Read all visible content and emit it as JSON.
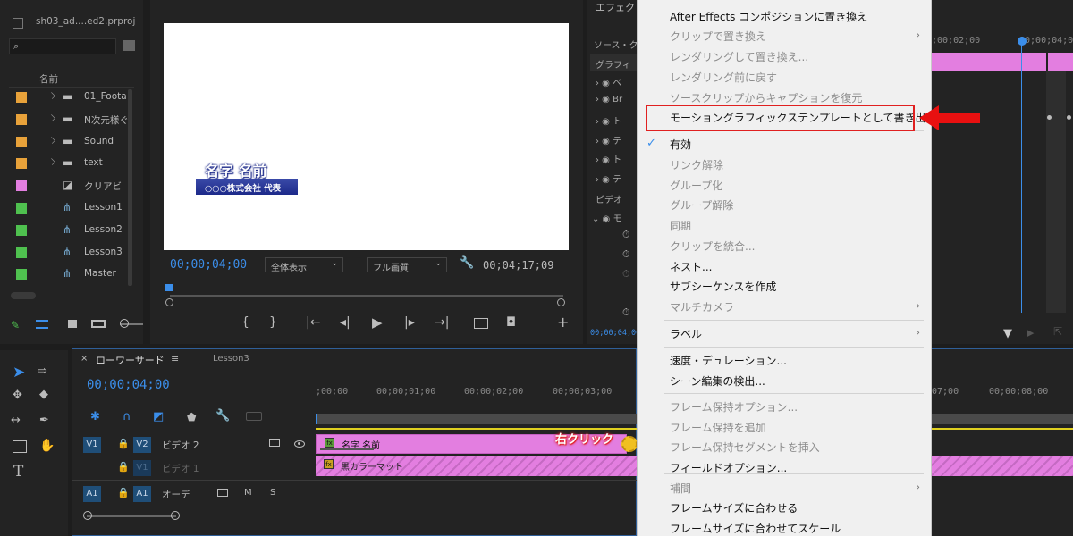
{
  "project": {
    "filename": "sh03_ad....ed2.prproj",
    "col_name": "名前",
    "items": [
      {
        "label": "01_Foota",
        "color": "#e8a23a",
        "kind": "folder"
      },
      {
        "label": "N次元様ぐ",
        "color": "#e8a23a",
        "kind": "folder"
      },
      {
        "label": "Sound",
        "color": "#e8a23a",
        "kind": "folder"
      },
      {
        "label": "text",
        "color": "#e8a23a",
        "kind": "folder"
      },
      {
        "label": "クリアビ",
        "color": "#e37ee0",
        "kind": "clip"
      },
      {
        "label": "Lesson1",
        "color": "#4fc14f",
        "kind": "seq"
      },
      {
        "label": "Lesson2",
        "color": "#4fc14f",
        "kind": "seq"
      },
      {
        "label": "Lesson3",
        "color": "#4fc14f",
        "kind": "seq"
      },
      {
        "label": "Master",
        "color": "#4fc14f",
        "kind": "seq"
      }
    ]
  },
  "program": {
    "lower_third_title": "名字 名前",
    "lower_third_sub": "○○○株式会社 代表",
    "timecode": "00;00;04;00",
    "zoom": "全体表示",
    "quality": "フル画質",
    "duration": "00;04;17;09"
  },
  "effects": {
    "header": "エフェク",
    "source": "ソース・ク",
    "graphics": "グラフィ",
    "video": "ビデオ",
    "ruler_t1": ";00;02;00",
    "ruler_t2": "00;00;04;00",
    "footer_tc": "00;00;04;00",
    "rows": [
      "ベ",
      "Br",
      "ト",
      "テ",
      "ト",
      "テ"
    ]
  },
  "menu": {
    "items": [
      {
        "label": "After Effects コンポジションに置き換え",
        "disabled": false
      },
      {
        "label": "クリップで置き換え",
        "disabled": true,
        "sub": true
      },
      {
        "label": "レンダリングして置き換え...",
        "disabled": true
      },
      {
        "label": "レンダリング前に戻す",
        "disabled": true
      },
      {
        "label": "ソースクリップからキャプションを復元",
        "disabled": true
      },
      {
        "label": "モーショングラフィックステンプレートとして書き出し...",
        "disabled": false,
        "highlight": true
      },
      {
        "label": "有効",
        "disabled": false,
        "checked": true
      },
      {
        "label": "リンク解除",
        "disabled": true
      },
      {
        "label": "グループ化",
        "disabled": true
      },
      {
        "label": "グループ解除",
        "disabled": true
      },
      {
        "label": "同期",
        "disabled": true
      },
      {
        "label": "クリップを統合...",
        "disabled": true
      },
      {
        "label": "ネスト...",
        "disabled": false
      },
      {
        "label": "サブシーケンスを作成",
        "disabled": false
      },
      {
        "label": "マルチカメラ",
        "disabled": true,
        "sub": true
      },
      {
        "label": "ラベル",
        "disabled": false,
        "sub": true
      },
      {
        "label": "速度・デュレーション...",
        "disabled": false
      },
      {
        "label": "シーン編集の検出...",
        "disabled": false
      },
      {
        "label": "フレーム保持オプション...",
        "disabled": true
      },
      {
        "label": "フレーム保持を追加",
        "disabled": true
      },
      {
        "label": "フレーム保持セグメントを挿入",
        "disabled": true
      },
      {
        "label": "フィールドオプション...",
        "disabled": false
      },
      {
        "label": "補間",
        "disabled": true,
        "sub": true
      },
      {
        "label": "フレームサイズに合わせる",
        "disabled": false
      },
      {
        "label": "フレームサイズに合わせてスケール",
        "disabled": false
      }
    ]
  },
  "timeline": {
    "tab_active": "ローワーサード",
    "tab_other": "Lesson3",
    "timecode": "00;00;04;00",
    "ruler": [
      ";00;00",
      "00;00;01;00",
      "00;00;02;00",
      "00;00;03;00"
    ],
    "ruler_right": [
      "07;00",
      "00;00;08;00"
    ],
    "v2_name": "ビデオ 2",
    "v1_name": "ビデオ 1",
    "a1_name": "オーデ",
    "clip_v2": "名字 名前",
    "clip_v1": "黒カラーマット",
    "annotation": "右クリック"
  },
  "colors": {
    "accent": "#3b8eea",
    "highlight_box": "#e02020",
    "clip_pink": "#e37ee0"
  }
}
